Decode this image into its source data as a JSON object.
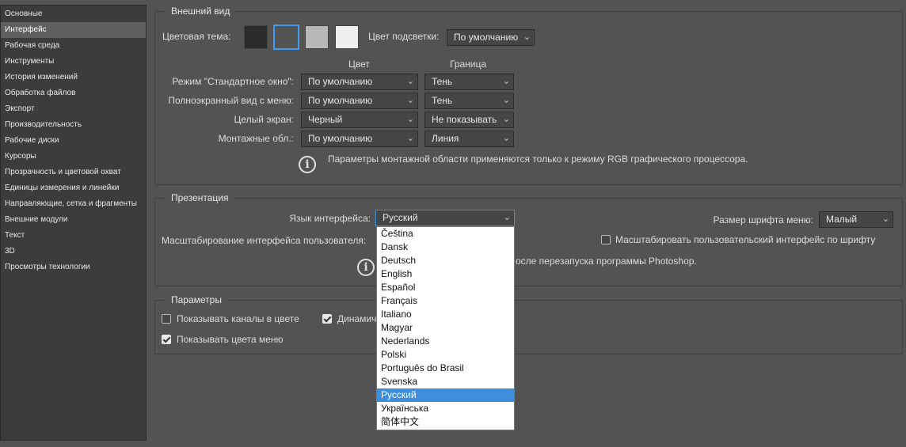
{
  "sidebar": {
    "items": [
      {
        "label": "Основные",
        "selected": false
      },
      {
        "label": "Интерфейс",
        "selected": true
      },
      {
        "label": "Рабочая среда",
        "selected": false
      },
      {
        "label": "Инструменты",
        "selected": false
      },
      {
        "label": "История изменений",
        "selected": false
      },
      {
        "label": "Обработка файлов",
        "selected": false
      },
      {
        "label": "Экспорт",
        "selected": false
      },
      {
        "label": "Производительность",
        "selected": false
      },
      {
        "label": "Рабочие диски",
        "selected": false
      },
      {
        "label": "Курсоры",
        "selected": false
      },
      {
        "label": "Прозрачность и цветовой охват",
        "selected": false
      },
      {
        "label": "Единицы измерения и линейки",
        "selected": false
      },
      {
        "label": "Направляющие, сетка и фрагменты",
        "selected": false
      },
      {
        "label": "Внешние модули",
        "selected": false
      },
      {
        "label": "Текст",
        "selected": false
      },
      {
        "label": "3D",
        "selected": false
      },
      {
        "label": "Просмотры технологии",
        "selected": false
      }
    ]
  },
  "appearance": {
    "title": "Внешний вид",
    "color_theme_label": "Цветовая тема:",
    "themes": [
      {
        "color": "#2b2b2b",
        "selected": false
      },
      {
        "color": "#535353",
        "selected": true
      },
      {
        "color": "#b8b8b8",
        "selected": false
      },
      {
        "color": "#f0f0f0",
        "selected": false
      }
    ],
    "highlight_label": "Цвет подсветки:",
    "highlight_value": "По умолчанию",
    "col_color": "Цвет",
    "col_border": "Граница",
    "rows": [
      {
        "label": "Режим \"Стандартное окно\":",
        "color": "По умолчанию",
        "border": "Тень"
      },
      {
        "label": "Полноэкранный вид с меню:",
        "color": "По умолчанию",
        "border": "Тень"
      },
      {
        "label": "Целый экран:",
        "color": "Черный",
        "border": "Не показывать"
      },
      {
        "label": "Монтажные обл.:",
        "color": "По умолчанию",
        "border": "Линия"
      }
    ],
    "info_text": "Параметры монтажной области применяются только к режиму RGB графического процессора."
  },
  "presentation": {
    "title": "Презентация",
    "lang_label": "Язык интерфейса:",
    "lang_value": "Русский",
    "font_size_label": "Размер шрифта меню:",
    "font_size_value": "Малый",
    "scaling_label": "Масштабирование интерфейса пользователя:",
    "scale_by_font_label": "Масштабировать пользовательский интерфейс по шрифту",
    "scale_by_font_checked": false,
    "info_text": "осле перезапуска программы Photoshop."
  },
  "options": {
    "title": "Параметры",
    "show_channels_label": "Показывать каналы в цвете",
    "show_channels_checked": false,
    "dynamic_label": "Динамич",
    "dynamic_checked": true,
    "show_menu_colors_label": "Показывать цвета меню",
    "show_menu_colors_checked": true
  },
  "language_dropdown": {
    "items": [
      "Čeština",
      "Dansk",
      "Deutsch",
      "English",
      "Español",
      "Français",
      "Italiano",
      "Magyar",
      "Nederlands",
      "Polski",
      "Português do Brasil",
      "Svenska",
      "Русский",
      "Українська",
      "简体中文"
    ],
    "active": "Русский"
  },
  "icons": {
    "dropdown_arrow": "chevron-down-icon",
    "info": "info-icon",
    "check": "checkmark-icon"
  }
}
